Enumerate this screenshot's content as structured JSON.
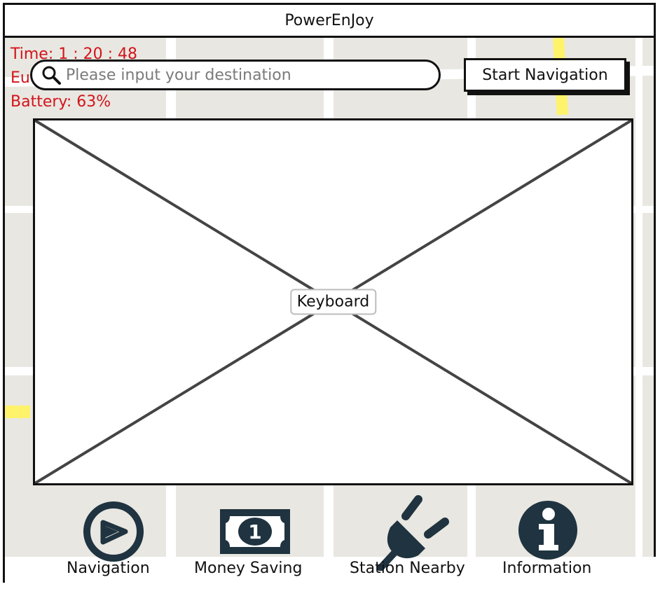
{
  "app": {
    "title": "PowerEnJoy"
  },
  "status": {
    "time": "Time: 1 : 20 : 48",
    "euro": "Eu",
    "battery": "Battery: 63%"
  },
  "search": {
    "placeholder": "Please input your destination",
    "value": ""
  },
  "actions": {
    "start_navigation": "Start Navigation"
  },
  "keyboard": {
    "label": "Keyboard"
  },
  "bottom_nav": {
    "items": [
      {
        "label": "Navigation",
        "icon": "compass-icon"
      },
      {
        "label": "Money Saving",
        "icon": "banknote-icon"
      },
      {
        "label": "Station Nearby",
        "icon": "plug-icon"
      },
      {
        "label": "Information",
        "icon": "info-icon"
      }
    ]
  },
  "colors": {
    "status_text": "#d2141b",
    "icon_fill": "#1f3340",
    "map_bg": "#e9e7e1",
    "highway": "#fff36b"
  }
}
